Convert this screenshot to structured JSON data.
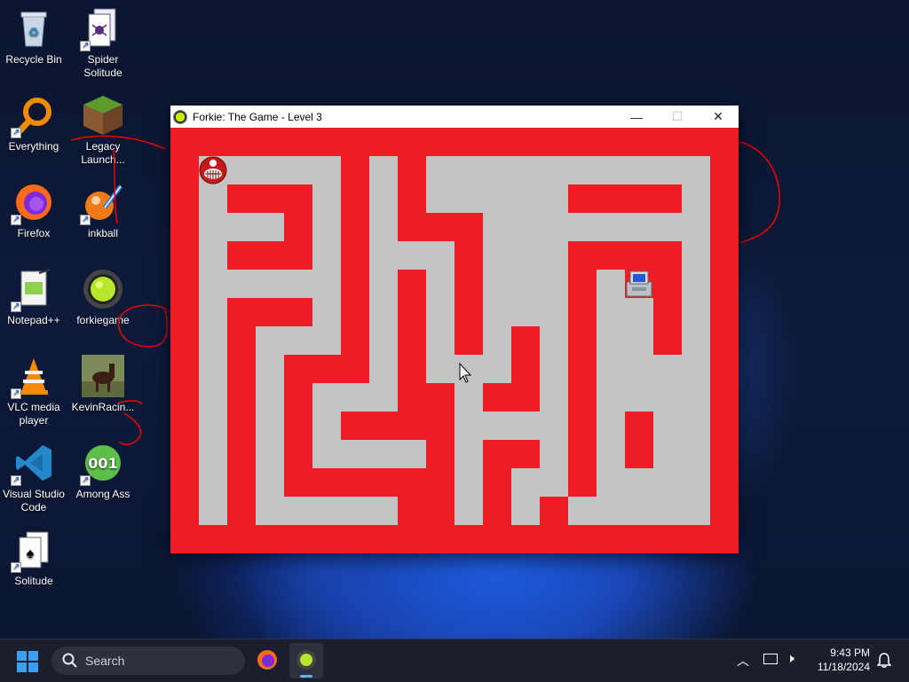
{
  "desktop": {
    "icons": [
      {
        "label": "Recycle Bin"
      },
      {
        "label": "Spider Solitude"
      },
      {
        "label": "Everything"
      },
      {
        "label": "Legacy Launch..."
      },
      {
        "label": "Firefox"
      },
      {
        "label": "inkball"
      },
      {
        "label": "Notepad++"
      },
      {
        "label": "forkiegame"
      },
      {
        "label": "VLC media player"
      },
      {
        "label": "KevinRacin..."
      },
      {
        "label": "Visual Studio Code"
      },
      {
        "label": "Among Ass"
      },
      {
        "label": "Solitude"
      }
    ]
  },
  "window": {
    "title": "Forkie: The Game - Level 3",
    "minimize_label": "—",
    "maximize_label": "☐",
    "close_label": "✕"
  },
  "game": {
    "wall_color": "#ed1c24",
    "path_color": "#c3c3c3",
    "player_icon": "forkie-face-icon",
    "goal_icon": "computer-icon"
  },
  "taskbar": {
    "search_placeholder": "Search",
    "time": "9:43 PM",
    "date": "11/18/2024"
  }
}
